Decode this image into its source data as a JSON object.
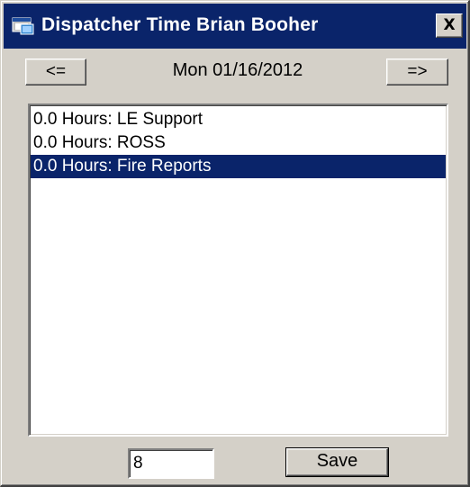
{
  "window": {
    "title": "Dispatcher Time Brian Booher",
    "close_label": "X"
  },
  "nav": {
    "prev_label": "<=",
    "next_label": "=>",
    "date": "Mon 01/16/2012"
  },
  "list": {
    "items": [
      {
        "label": "0.0 Hours: LE Support",
        "selected": false
      },
      {
        "label": "0.0 Hours: ROSS",
        "selected": false
      },
      {
        "label": "0.0 Hours: Fire Reports",
        "selected": true
      }
    ]
  },
  "hours_input": {
    "value": "8"
  },
  "actions": {
    "save_label": "Save"
  },
  "colors": {
    "titlebar": "#0a246a",
    "selection": "#0a246a",
    "face": "#d4d0c8"
  },
  "icons": {
    "app": "window-app-icon",
    "close": "close-icon"
  }
}
